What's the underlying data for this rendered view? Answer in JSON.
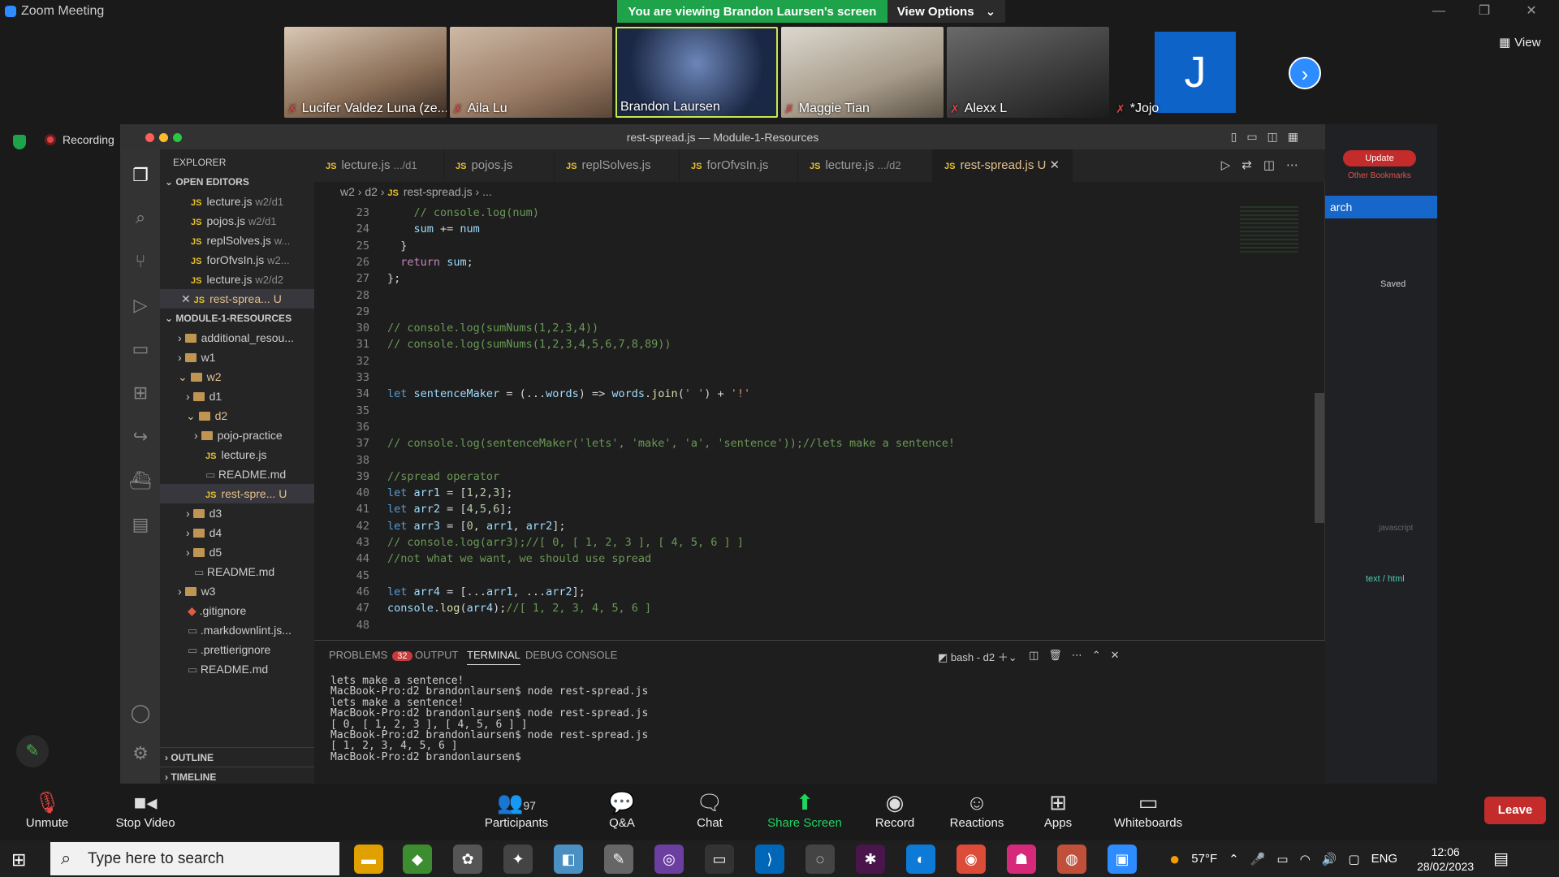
{
  "zoom": {
    "app_title": "Zoom Meeting",
    "viewing_banner": "You are viewing Brandon Laursen's screen",
    "view_options": "View Options",
    "view_button": "View",
    "recording": "Recording",
    "participants_gallery": [
      "Lucifer Valdez Luna (ze...",
      "Aila Lu",
      "Brandon Laursen",
      "Maggie Tian",
      "Alexx L",
      "*Jojo"
    ],
    "avatar_letter": "J",
    "toolbar": [
      {
        "label": "Unmute",
        "icon": "mic-muted-icon"
      },
      {
        "label": "Stop Video",
        "icon": "video-icon"
      },
      {
        "label": "Participants",
        "icon": "participants-icon",
        "count": "97"
      },
      {
        "label": "Q&A",
        "icon": "qa-icon"
      },
      {
        "label": "Chat",
        "icon": "chat-icon"
      },
      {
        "label": "Share Screen",
        "icon": "share-screen-icon"
      },
      {
        "label": "Record",
        "icon": "record-icon"
      },
      {
        "label": "Reactions",
        "icon": "reactions-icon"
      },
      {
        "label": "Apps",
        "icon": "apps-icon"
      },
      {
        "label": "Whiteboards",
        "icon": "whiteboards-icon"
      }
    ],
    "leave": "Leave"
  },
  "vscode": {
    "window_title": "rest-spread.js — Module-1-Resources",
    "explorer_title": "EXPLORER",
    "open_editors_title": "OPEN EDITORS",
    "open_editors": [
      {
        "name": "lecture.js",
        "path": "w2/d1"
      },
      {
        "name": "pojos.js",
        "path": "w2/d1"
      },
      {
        "name": "replSolves.js",
        "path": "w..."
      },
      {
        "name": "forOfvsIn.js",
        "path": "w2..."
      },
      {
        "name": "lecture.js",
        "path": "w2/d2"
      },
      {
        "name": "rest-sprea...",
        "path": "U"
      }
    ],
    "project_title": "MODULE-1-RESOURCES",
    "tree": [
      "additional_resou...",
      "w1",
      "w2",
      "d1",
      "d2",
      "pojo-practice",
      "lecture.js",
      "README.md",
      "rest-spre...",
      "d3",
      "d4",
      "d5",
      "README.md",
      "w3",
      ".gitignore",
      ".markdownlint.js...",
      ".prettierignore",
      "README.md"
    ],
    "outline": "OUTLINE",
    "timeline": "TIMELINE",
    "tabs": [
      {
        "name": "lecture.js",
        "hint": ".../d1"
      },
      {
        "name": "pojos.js",
        "hint": ""
      },
      {
        "name": "replSolves.js",
        "hint": ""
      },
      {
        "name": "forOfvsIn.js",
        "hint": ""
      },
      {
        "name": "lecture.js",
        "hint": ".../d2"
      },
      {
        "name": "rest-spread.js",
        "hint": "U"
      }
    ],
    "breadcrumb": [
      "w2",
      "d2",
      "rest-spread.js",
      "..."
    ],
    "code_lines": [
      {
        "n": "23",
        "t": "    // console.log(num)"
      },
      {
        "n": "24",
        "t": "    sum += num"
      },
      {
        "n": "25",
        "t": "  }"
      },
      {
        "n": "26",
        "t": "  return sum;"
      },
      {
        "n": "27",
        "t": "};"
      },
      {
        "n": "28",
        "t": ""
      },
      {
        "n": "29",
        "t": ""
      },
      {
        "n": "30",
        "t": "// console.log(sumNums(1,2,3,4))"
      },
      {
        "n": "31",
        "t": "// console.log(sumNums(1,2,3,4,5,6,7,8,89))"
      },
      {
        "n": "32",
        "t": ""
      },
      {
        "n": "33",
        "t": ""
      },
      {
        "n": "34",
        "t": "let sentenceMaker = (...words) => words.join(' ') + '!'"
      },
      {
        "n": "35",
        "t": ""
      },
      {
        "n": "36",
        "t": ""
      },
      {
        "n": "37",
        "t": "// console.log(sentenceMaker('lets', 'make', 'a', 'sentence'));//lets make a sentence!"
      },
      {
        "n": "38",
        "t": ""
      },
      {
        "n": "39",
        "t": "//spread operator"
      },
      {
        "n": "40",
        "t": "let arr1 = [1,2,3];"
      },
      {
        "n": "41",
        "t": "let arr2 = [4,5,6];"
      },
      {
        "n": "42",
        "t": "let arr3 = [0, arr1, arr2];"
      },
      {
        "n": "43",
        "t": "// console.log(arr3);//[ 0, [ 1, 2, 3 ], [ 4, 5, 6 ] ]"
      },
      {
        "n": "44",
        "t": "//not what we want, we should use spread"
      },
      {
        "n": "45",
        "t": ""
      },
      {
        "n": "46",
        "t": "let arr4 = [...arr1, ...arr2];"
      },
      {
        "n": "47",
        "t": "console.log(arr4);//[ 1, 2, 3, 4, 5, 6 ]"
      },
      {
        "n": "48",
        "t": ""
      }
    ],
    "panel_tabs": {
      "problems": "PROBLEMS",
      "problems_count": "32",
      "output": "OUTPUT",
      "terminal": "TERMINAL",
      "debug": "DEBUG CONSOLE"
    },
    "terminal_name": "bash - d2",
    "terminal_lines": [
      "lets make a sentence!",
      "MacBook-Pro:d2 brandonlaursen$ node rest-spread.js",
      "lets make a sentence!",
      "MacBook-Pro:d2 brandonlaursen$ node rest-spread.js",
      "[ 0, [ 1, 2, 3 ], [ 4, 5, 6 ] ]",
      "MacBook-Pro:d2 brandonlaursen$ node rest-spread.js",
      "[ 1, 2, 3, 4, 5, 6 ]",
      "MacBook-Pro:d2 brandonlaursen$ "
    ]
  },
  "browser_partial": {
    "update": "Update",
    "bookmarks": "Other Bookmarks",
    "search_fragment": "arch",
    "saved": "Saved",
    "lang": "javascript",
    "mime": "text / html"
  },
  "taskbar": {
    "search_placeholder": "Type here to search",
    "weather": "57°F",
    "lang": "ENG",
    "time": "12:06",
    "date": "28/02/2023"
  },
  "colors": {
    "zoom_green": "#1fa34a",
    "zoom_blue": "#2d8cff",
    "leave_red": "#c42b2b",
    "vscode_bg": "#1e1e1e"
  }
}
